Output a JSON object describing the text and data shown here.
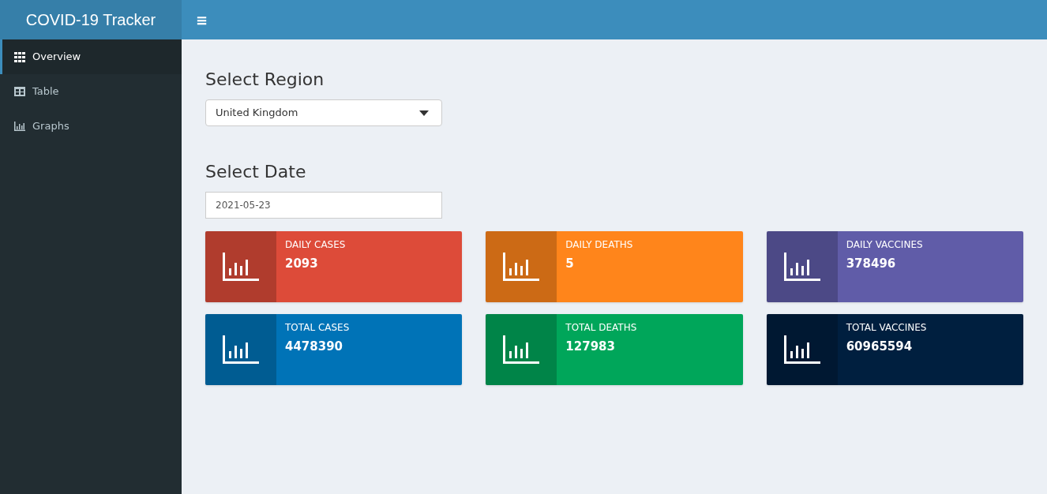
{
  "header": {
    "title": "COVID-19 Tracker",
    "menu_glyph": "≡"
  },
  "sidebar": {
    "items": [
      {
        "label": "Overview",
        "kind": "grid",
        "selected": true
      },
      {
        "label": "Table",
        "kind": "table",
        "selected": false
      },
      {
        "label": "Graphs",
        "kind": "chart",
        "selected": false
      }
    ]
  },
  "region": {
    "heading": "Select Region",
    "value": "United Kingdom"
  },
  "date": {
    "heading": "Select Date",
    "value": "2021-05-23"
  },
  "info_boxes": [
    {
      "label": "DAILY CASES",
      "value": "2093",
      "color": "#dd4b39"
    },
    {
      "label": "DAILY DEATHS",
      "value": "5",
      "color": "#ff851b"
    },
    {
      "label": "DAILY VACCINES",
      "value": "378496",
      "color": "#605ca8"
    },
    {
      "label": "TOTAL CASES",
      "value": "4478390",
      "color": "#0073b7"
    },
    {
      "label": "TOTAL DEATHS",
      "value": "127983",
      "color": "#00a65a"
    },
    {
      "label": "TOTAL VACCINES",
      "value": "60965594",
      "color": "#001f3f"
    }
  ]
}
